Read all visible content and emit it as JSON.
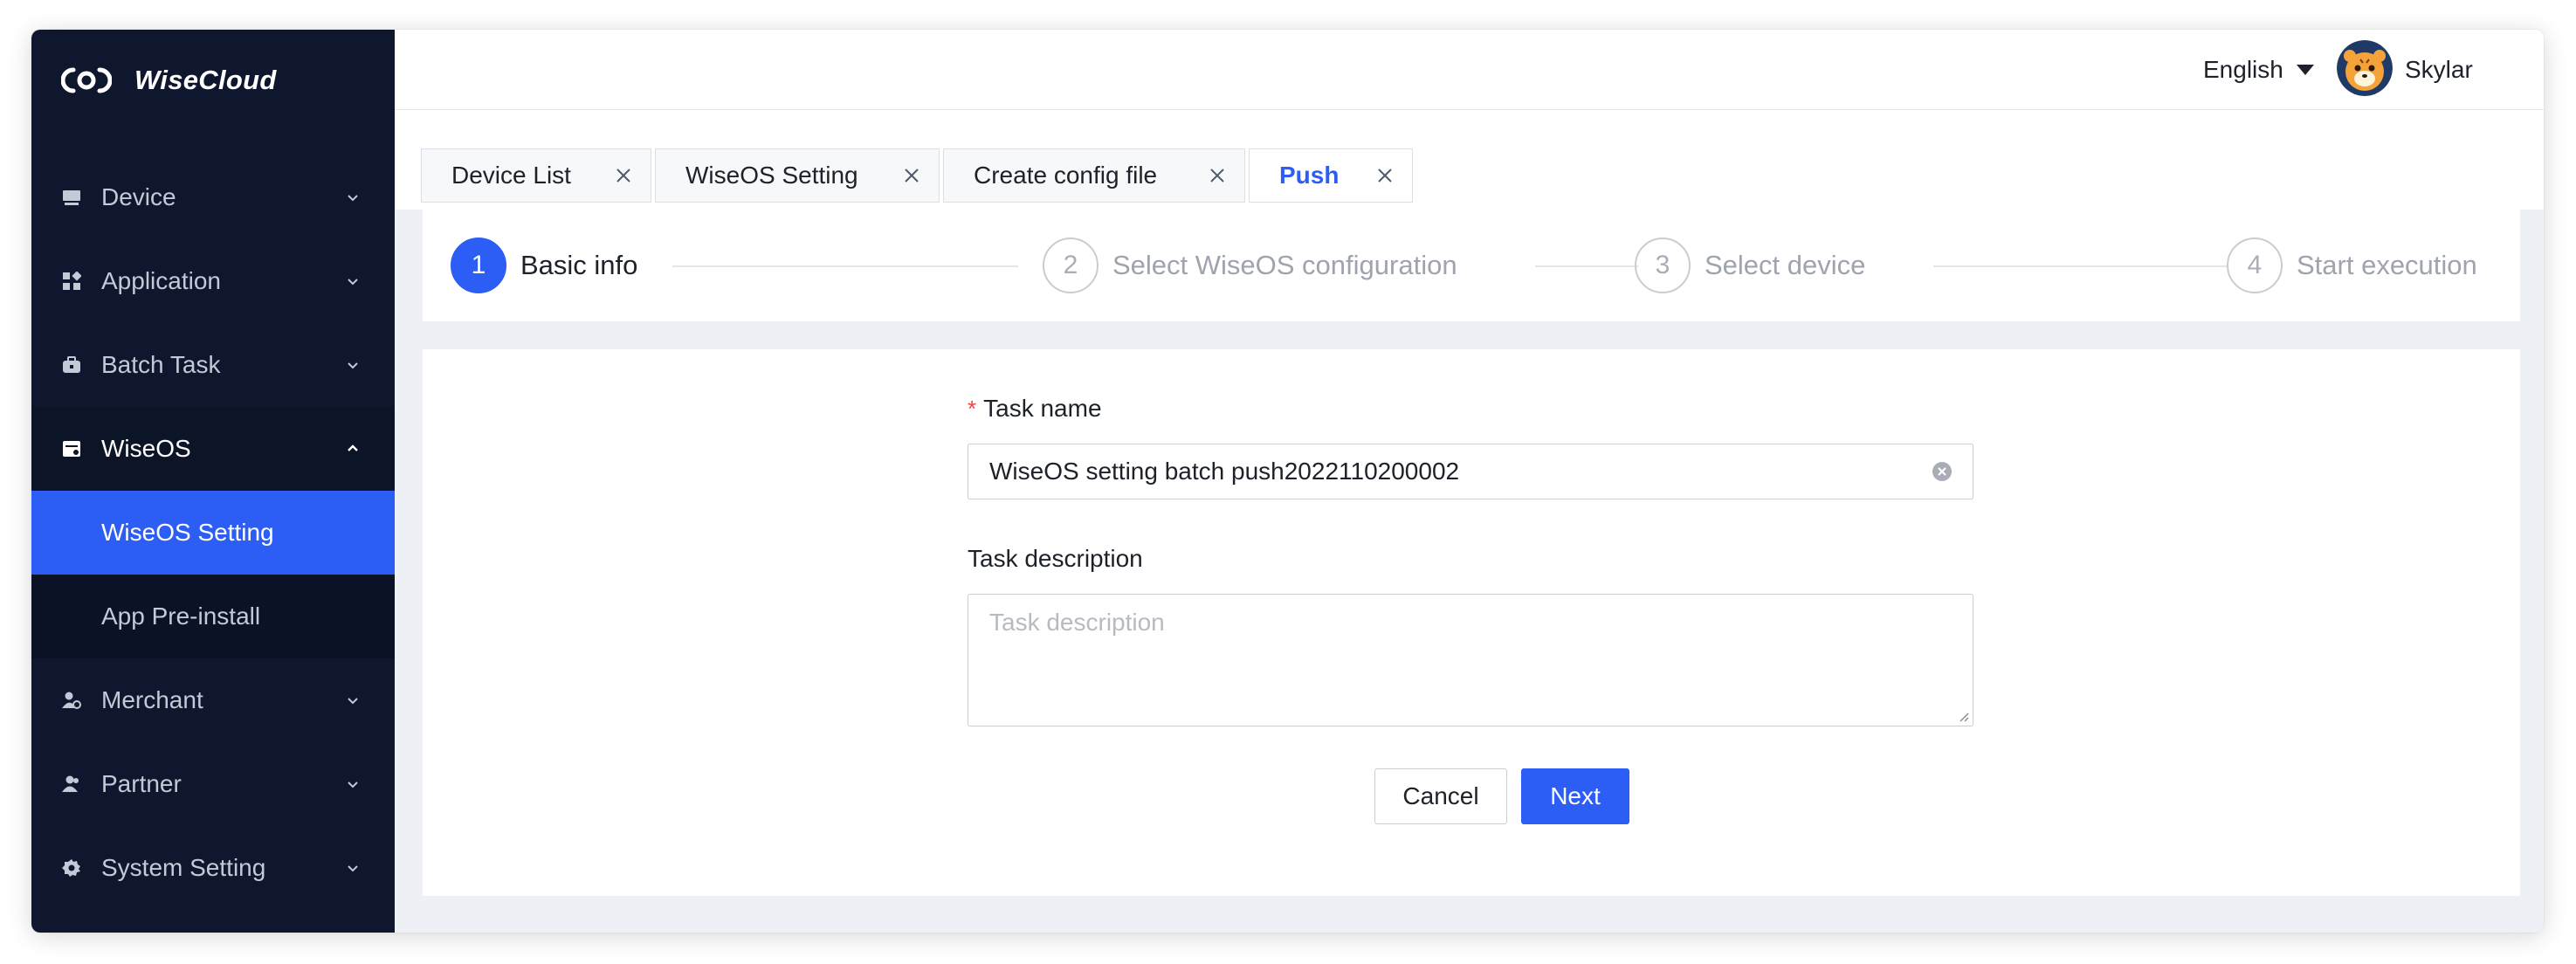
{
  "app": {
    "name": "WiseCloud",
    "logo_icon": "wisecloud-logo"
  },
  "sidebar": {
    "items": [
      {
        "label": "Device",
        "icon": "device-icon",
        "state": "collapsed"
      },
      {
        "label": "Application",
        "icon": "application-icon",
        "state": "collapsed"
      },
      {
        "label": "Batch Task",
        "icon": "batch-task-icon",
        "state": "collapsed"
      },
      {
        "label": "WiseOS",
        "icon": "wiseos-icon",
        "state": "expanded",
        "children": [
          {
            "label": "WiseOS Setting",
            "active": true
          },
          {
            "label": "App Pre-install",
            "active": false
          }
        ]
      },
      {
        "label": "Merchant",
        "icon": "merchant-icon",
        "state": "collapsed"
      },
      {
        "label": "Partner",
        "icon": "partner-icon",
        "state": "collapsed"
      },
      {
        "label": "System Setting",
        "icon": "gear-icon",
        "state": "collapsed"
      }
    ]
  },
  "header": {
    "language": "English",
    "username": "Skylar"
  },
  "tabs": [
    {
      "label": "Device List",
      "active": false
    },
    {
      "label": "WiseOS Setting",
      "active": false
    },
    {
      "label": "Create config file",
      "active": false
    },
    {
      "label": "Push",
      "active": true
    }
  ],
  "steps": [
    {
      "number": "1",
      "label": "Basic info",
      "active": true
    },
    {
      "number": "2",
      "label": "Select WiseOS configuration",
      "active": false
    },
    {
      "number": "3",
      "label": "Select device",
      "active": false
    },
    {
      "number": "4",
      "label": "Start execution",
      "active": false
    }
  ],
  "form": {
    "task_name": {
      "label": "Task name",
      "required_mark": "*",
      "value": "WiseOS setting batch push2022110200002"
    },
    "task_description": {
      "label": "Task description",
      "placeholder": "Task description",
      "value": ""
    },
    "buttons": {
      "cancel": "Cancel",
      "next": "Next"
    }
  },
  "colors": {
    "sidebar_bg": "#0f172e",
    "primary": "#2c5ef5",
    "required": "#f53f3f",
    "page_bg": "#edf0f4"
  }
}
